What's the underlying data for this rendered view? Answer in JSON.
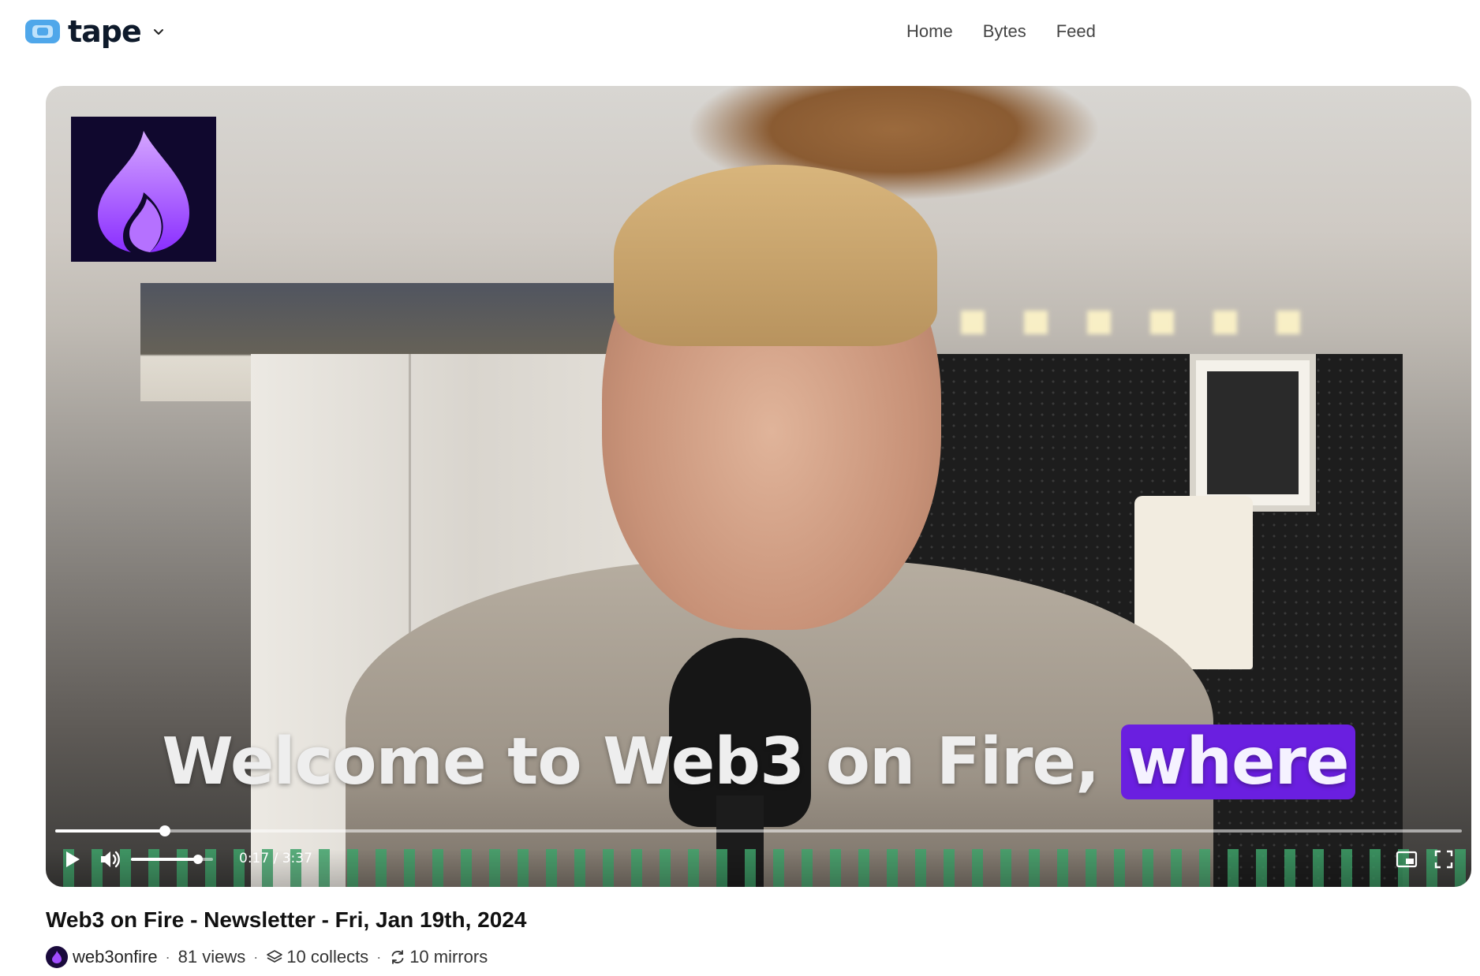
{
  "header": {
    "logo_text": "tape",
    "nav": [
      {
        "label": "Home"
      },
      {
        "label": "Bytes"
      },
      {
        "label": "Feed"
      }
    ]
  },
  "player": {
    "caption_text": "Welcome to Web3 on Fire, ",
    "caption_highlight": "where",
    "progress_fraction": 0.078,
    "volume_fraction": 0.82,
    "current_time": "0:17",
    "duration": "3:37",
    "time_display": "0:17 / 3:37",
    "colors": {
      "caption_highlight": "#6a1fe0",
      "waveform": "#3fa36a",
      "channel_logo_bg": "#10082e",
      "flame": "#a24dff"
    }
  },
  "video": {
    "title": "Web3 on Fire - Newsletter - Fri, Jan 19th, 2024",
    "channel": "web3onfire",
    "views": "81 views",
    "collects": "10 collects",
    "mirrors": "10 mirrors"
  },
  "icons": {
    "logo": "tape-logo-icon",
    "dropdown": "chevron-down-icon",
    "play": "play-icon",
    "volume": "volume-icon",
    "pip": "picture-in-picture-icon",
    "fullscreen": "fullscreen-icon",
    "collects": "layers-icon",
    "mirrors": "refresh-icon"
  }
}
